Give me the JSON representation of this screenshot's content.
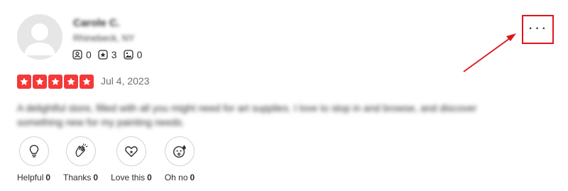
{
  "review": {
    "user": {
      "name": "Carole C.",
      "location": "Rhinebeck, NY",
      "stats": [
        {
          "icon": "friends-icon",
          "count": "0"
        },
        {
          "icon": "review-star-icon",
          "count": "3"
        },
        {
          "icon": "photo-icon",
          "count": "0"
        }
      ]
    },
    "rating": 5,
    "date": "Jul 4, 2023",
    "text": "A delightful store, filled with all you might need for art supplies. I love to stop in and browse, and discover something new for my painting needs."
  },
  "reactions": [
    {
      "icon": "lightbulb-icon",
      "label": "Helpful",
      "count": "0"
    },
    {
      "icon": "clapping-hands-icon",
      "label": "Thanks",
      "count": "0"
    },
    {
      "icon": "heart-icon",
      "label": "Love this",
      "count": "0"
    },
    {
      "icon": "oh-no-face-icon",
      "label": "Oh no",
      "count": "0"
    }
  ],
  "more_menu": {
    "label": "···",
    "icon": "more-options-icon"
  },
  "colors": {
    "star_red": "#f43939",
    "annotation_red": "#e0141e"
  }
}
